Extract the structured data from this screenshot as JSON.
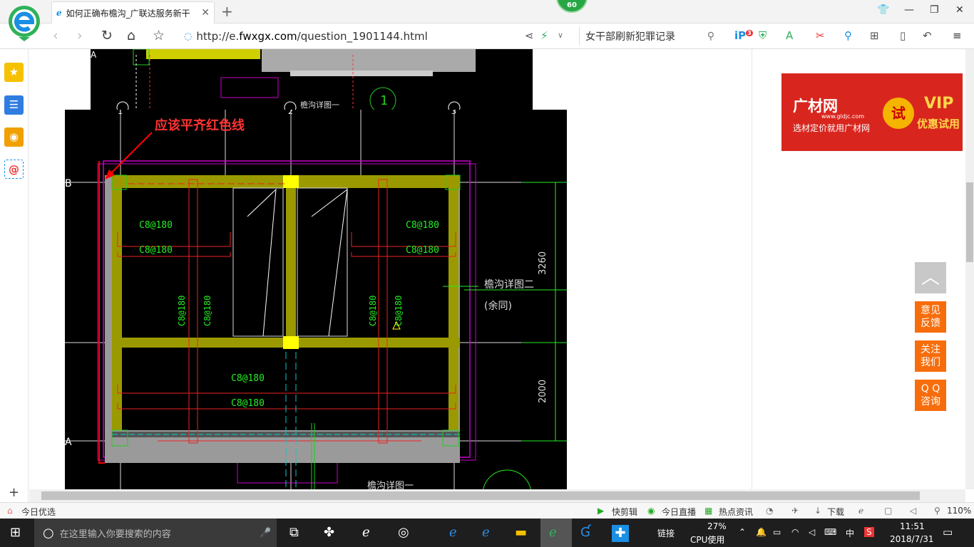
{
  "tab": {
    "title": "如何正确布檐沟_广联达服务新干",
    "close": "✕",
    "new": "+"
  },
  "badge": "60",
  "address": {
    "url_prefix": "http://e.",
    "url_domain": "fwxgx.com",
    "url_suffix": "/question_1901144.html",
    "search_text": "女干部刷新犯罪记录"
  },
  "toolbar": {
    "ip_badge": "3"
  },
  "ad": {
    "brand": "广材网",
    "domain": "www.gldjc.com",
    "slogan": "选材定价就用广材网",
    "try": "试",
    "vip": "VIP",
    "offer": "优惠试用"
  },
  "float_buttons": [
    {
      "line1": "意见",
      "line2": "反馈"
    },
    {
      "line1": "关注",
      "line2": "我们"
    },
    {
      "line1": "Q Q",
      "line2": "咨询"
    }
  ],
  "cad": {
    "annotation": "应该平齐红色线",
    "axis_labels": {
      "a_top": "A",
      "b": "B",
      "a_bottom": "A",
      "n1": "1",
      "n2": "2",
      "n3": "3",
      "c1": "1"
    },
    "rebar_top_left_1": "C8@180",
    "rebar_top_left_2": "C8@180",
    "rebar_top_right_1": "C8@180",
    "rebar_top_right_2": "C8@180",
    "rebar_bottom_1": "C8@180",
    "rebar_bottom_2": "C8@180",
    "rebar_v1": "C8@180",
    "rebar_v2": "C8@180",
    "rebar_v3": "C8@180",
    "rebar_v4": "C8@180",
    "detail_label": "檐沟详图二",
    "detail_note": "(余同)",
    "detail_top": "檐沟详图一",
    "detail_bottom": "檐沟详图一",
    "dim_1": "3260",
    "dim_2": "2000"
  },
  "status": {
    "today": "今日优选",
    "kuaijianji": "快剪辑",
    "live": "今日直播",
    "news": "热点资讯",
    "download": "下载",
    "zoom": "110%"
  },
  "taskbar": {
    "search_placeholder": "在这里输入你要搜索的内容",
    "link": "链接",
    "cpu_pct": "27%",
    "cpu_label": "CPU使用",
    "ime": "中",
    "time": "11:51",
    "date": "2018/7/31"
  }
}
